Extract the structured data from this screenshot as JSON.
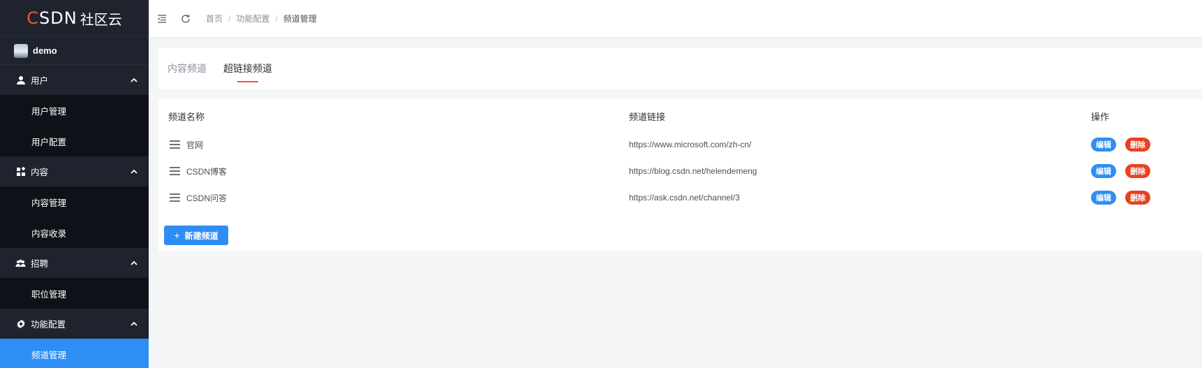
{
  "brand": {
    "logo_mark": "CSDN",
    "logo_text": "社区云"
  },
  "user": {
    "name": "demo"
  },
  "sidebar": {
    "groups": [
      {
        "label": "用户",
        "icon": "user-icon",
        "items": [
          {
            "label": "用户管理"
          },
          {
            "label": "用户配置"
          }
        ]
      },
      {
        "label": "内容",
        "icon": "content-icon",
        "items": [
          {
            "label": "内容管理"
          },
          {
            "label": "内容收录"
          }
        ]
      },
      {
        "label": "招聘",
        "icon": "recruit-icon",
        "items": [
          {
            "label": "职位管理"
          }
        ]
      },
      {
        "label": "功能配置",
        "icon": "gear-icon",
        "items": [
          {
            "label": "频道管理",
            "active": true
          }
        ]
      }
    ]
  },
  "breadcrumb": {
    "home": "首页",
    "section": "功能配置",
    "current": "频道管理",
    "separator": "/"
  },
  "tabs": [
    {
      "label": "内容频道",
      "active": false
    },
    {
      "label": "超链接频道",
      "active": true
    }
  ],
  "table": {
    "headers": {
      "name": "频道名称",
      "link": "频道链接",
      "actions": "操作"
    },
    "rows": [
      {
        "name": "官网",
        "link": "https://www.microsoft.com/zh-cn/"
      },
      {
        "name": "CSDN博客",
        "link": "https://blog.csdn.net/helendemeng"
      },
      {
        "name": "CSDN问答",
        "link": "https://ask.csdn.net/channel/3"
      }
    ],
    "edit_label": "编辑",
    "delete_label": "删除"
  },
  "add_button": {
    "label": "新建频道",
    "icon": "plus-icon"
  },
  "colors": {
    "sidebar_bg": "#141821",
    "accent": "#2f8ef4",
    "danger": "#e8411f",
    "brand_red": "#fc5531"
  }
}
